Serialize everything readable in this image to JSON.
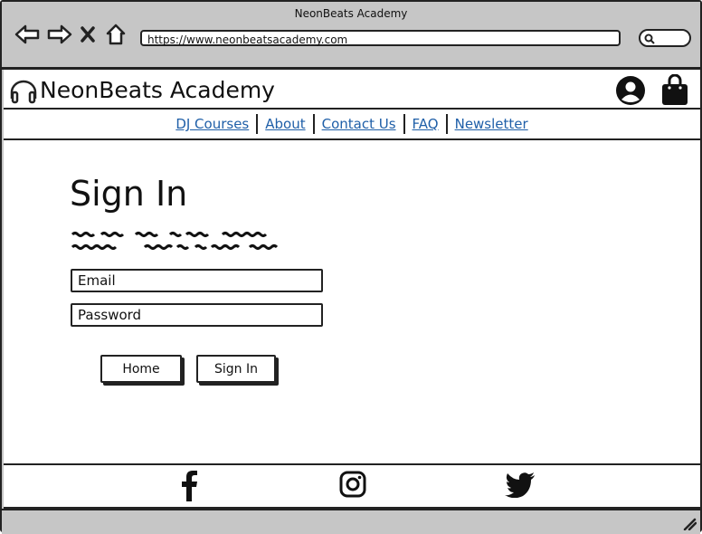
{
  "window": {
    "title": "NeonBeats Academy"
  },
  "browser": {
    "url": "https://www.neonbeatsacademy.com",
    "icons": [
      "back-arrow-icon",
      "forward-arrow-icon",
      "close-icon",
      "home-icon",
      "search-icon"
    ]
  },
  "header": {
    "brand": "NeonBeats Academy",
    "icons": [
      "headphones-icon",
      "user-icon",
      "shopping-bag-icon"
    ]
  },
  "nav": {
    "items": [
      {
        "label": "DJ Courses"
      },
      {
        "label": "About"
      },
      {
        "label": "Contact Us"
      },
      {
        "label": "FAQ"
      },
      {
        "label": "Newsletter"
      }
    ],
    "link_color": "#1f5fa8"
  },
  "signin": {
    "title": "Sign In",
    "email_placeholder": "Email",
    "password_placeholder": "Password",
    "home_button": "Home",
    "submit_button": "Sign In"
  },
  "footer": {
    "icons": [
      "facebook-icon",
      "instagram-icon",
      "twitter-icon"
    ]
  }
}
